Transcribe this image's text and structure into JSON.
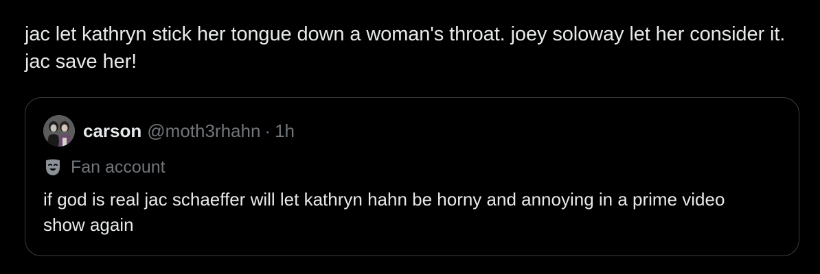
{
  "tweet": {
    "text": "jac let kathryn stick her tongue down a woman's throat. joey soloway let her consider it. jac save her!"
  },
  "quote": {
    "display_name": "carson",
    "handle": "@moth3rhahn",
    "separator": "·",
    "time": "1h",
    "label_icon": "theater-mask-icon",
    "label": "Fan account",
    "text": "if god is real jac schaeffer will let kathryn hahn be horny and annoying in a prime video show again"
  },
  "colors": {
    "background": "#000000",
    "primary_text": "#e7e9ea",
    "secondary_text": "#71767b",
    "border": "#3a3e42"
  }
}
